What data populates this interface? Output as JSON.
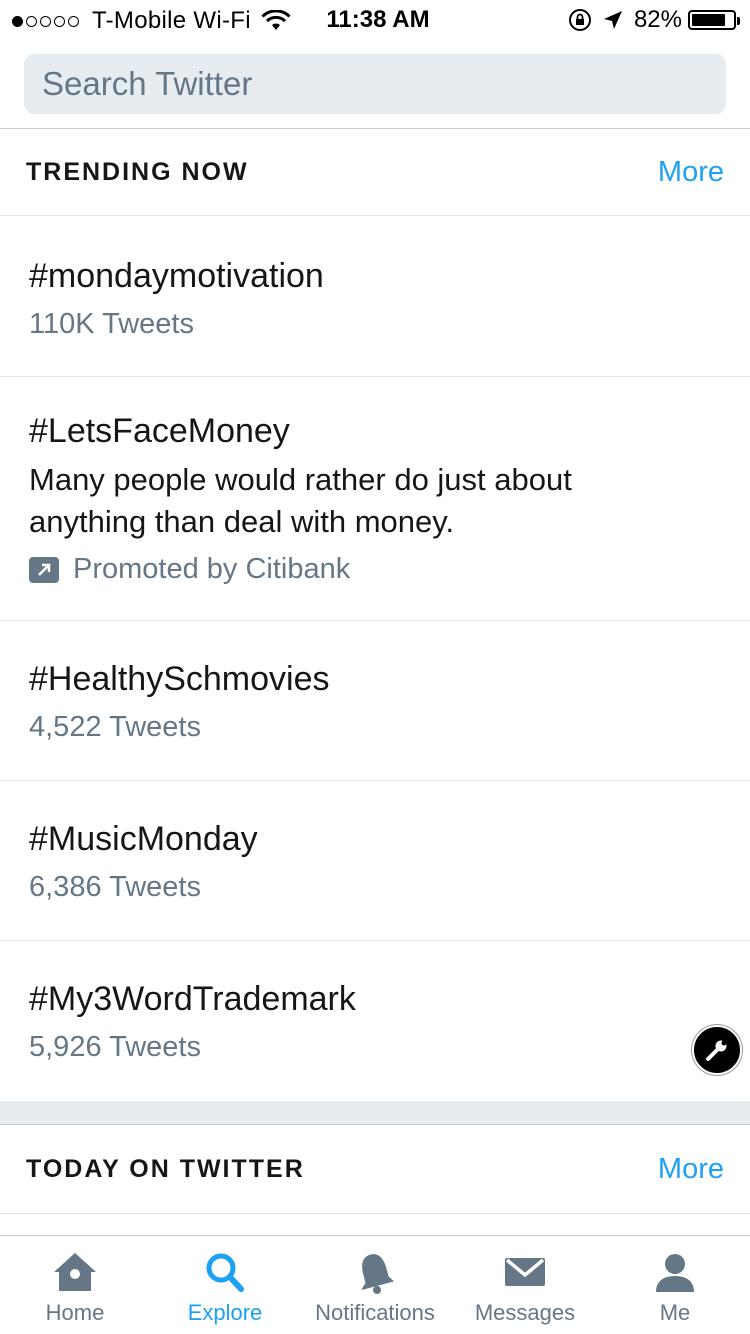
{
  "status_bar": {
    "carrier": "T-Mobile Wi-Fi",
    "time": "11:38 AM",
    "battery_percent": "82%",
    "battery_level": 0.82,
    "signal_dots_filled": 1,
    "signal_dots_total": 5
  },
  "search": {
    "placeholder": "Search Twitter",
    "value": ""
  },
  "trending": {
    "title": "TRENDING NOW",
    "more_label": "More",
    "items": [
      {
        "name": "#mondaymotivation",
        "count": "110K Tweets"
      },
      {
        "name": "#LetsFaceMoney",
        "description": "Many people would rather do just about anything than deal with money.",
        "promoted": "Promoted by Citibank"
      },
      {
        "name": "#HealthySchmovies",
        "count": "4,522 Tweets"
      },
      {
        "name": "#MusicMonday",
        "count": "6,386 Tweets"
      },
      {
        "name": "#My3WordTrademark",
        "count": "5,926 Tweets"
      }
    ]
  },
  "today": {
    "title": "TODAY ON TWITTER",
    "more_label": "More"
  },
  "tabs": [
    {
      "label": "Home",
      "icon": "home-icon",
      "active": false
    },
    {
      "label": "Explore",
      "icon": "search-icon",
      "active": true
    },
    {
      "label": "Notifications",
      "icon": "bell-icon",
      "active": false
    },
    {
      "label": "Messages",
      "icon": "envelope-icon",
      "active": false
    },
    {
      "label": "Me",
      "icon": "person-icon",
      "active": false
    }
  ],
  "colors": {
    "accent": "#1da1f2",
    "secondary_text": "#657786",
    "search_bg": "#e6ecf0"
  }
}
